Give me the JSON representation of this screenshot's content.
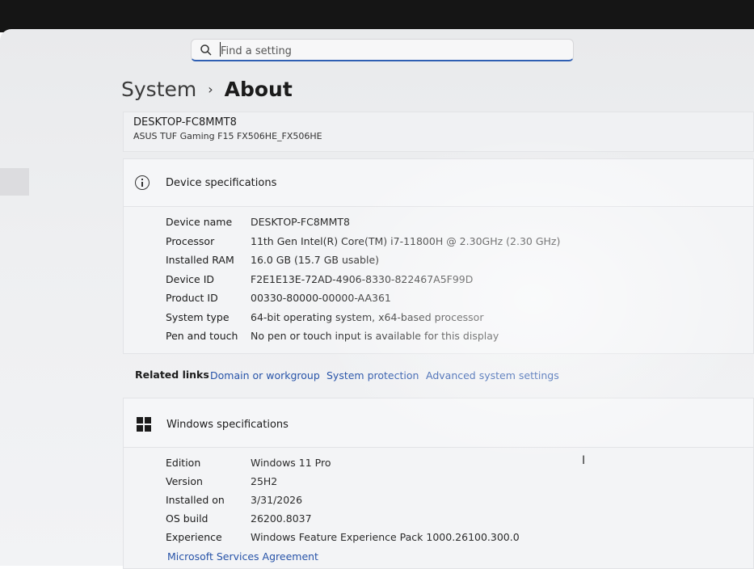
{
  "search": {
    "placeholder": "Find a setting"
  },
  "breadcrumb": {
    "parent": "System",
    "separator": "›",
    "current": "About"
  },
  "pc": {
    "name": "DESKTOP-FC8MMT8",
    "model": "ASUS TUF Gaming F15 FX506HE_FX506HE"
  },
  "device_specs": {
    "title": "Device specifications",
    "rows": [
      {
        "label": "Device name",
        "value": "DESKTOP-FC8MMT8"
      },
      {
        "label": "Processor",
        "value": "11th Gen Intel(R) Core(TM) i7-11800H @ 2.30GHz (2.30 GHz)"
      },
      {
        "label": "Installed RAM",
        "value": "16.0 GB (15.7 GB usable)"
      },
      {
        "label": "Device ID",
        "value": "F2E1E13E-72AD-4906-8330-822467A5F99D"
      },
      {
        "label": "Product ID",
        "value": "00330-80000-00000-AA361"
      },
      {
        "label": "System type",
        "value": "64-bit operating system, x64-based processor"
      },
      {
        "label": "Pen and touch",
        "value": "No pen or touch input is available for this display"
      }
    ]
  },
  "related": {
    "label": "Related links",
    "links": [
      "Domain or workgroup",
      "System protection",
      "Advanced system settings"
    ]
  },
  "windows_specs": {
    "title": "Windows specifications",
    "rows": [
      {
        "label": "Edition",
        "value": "Windows 11 Pro"
      },
      {
        "label": "Version",
        "value": "25H2"
      },
      {
        "label": "Installed on",
        "value": "3/31/2026"
      },
      {
        "label": "OS build",
        "value": "26200.8037"
      },
      {
        "label": "Experience",
        "value": "Windows Feature Experience Pack 1000.26100.300.0"
      }
    ],
    "agreement_link": "Microsoft Services Agreement"
  },
  "icons": {
    "search": "search-icon",
    "info": "info-icon",
    "windows": "windows-logo-icon",
    "cursor": "text-cursor-icon"
  },
  "colors": {
    "link": "#2753a8",
    "accent": "#2f5fb3"
  }
}
